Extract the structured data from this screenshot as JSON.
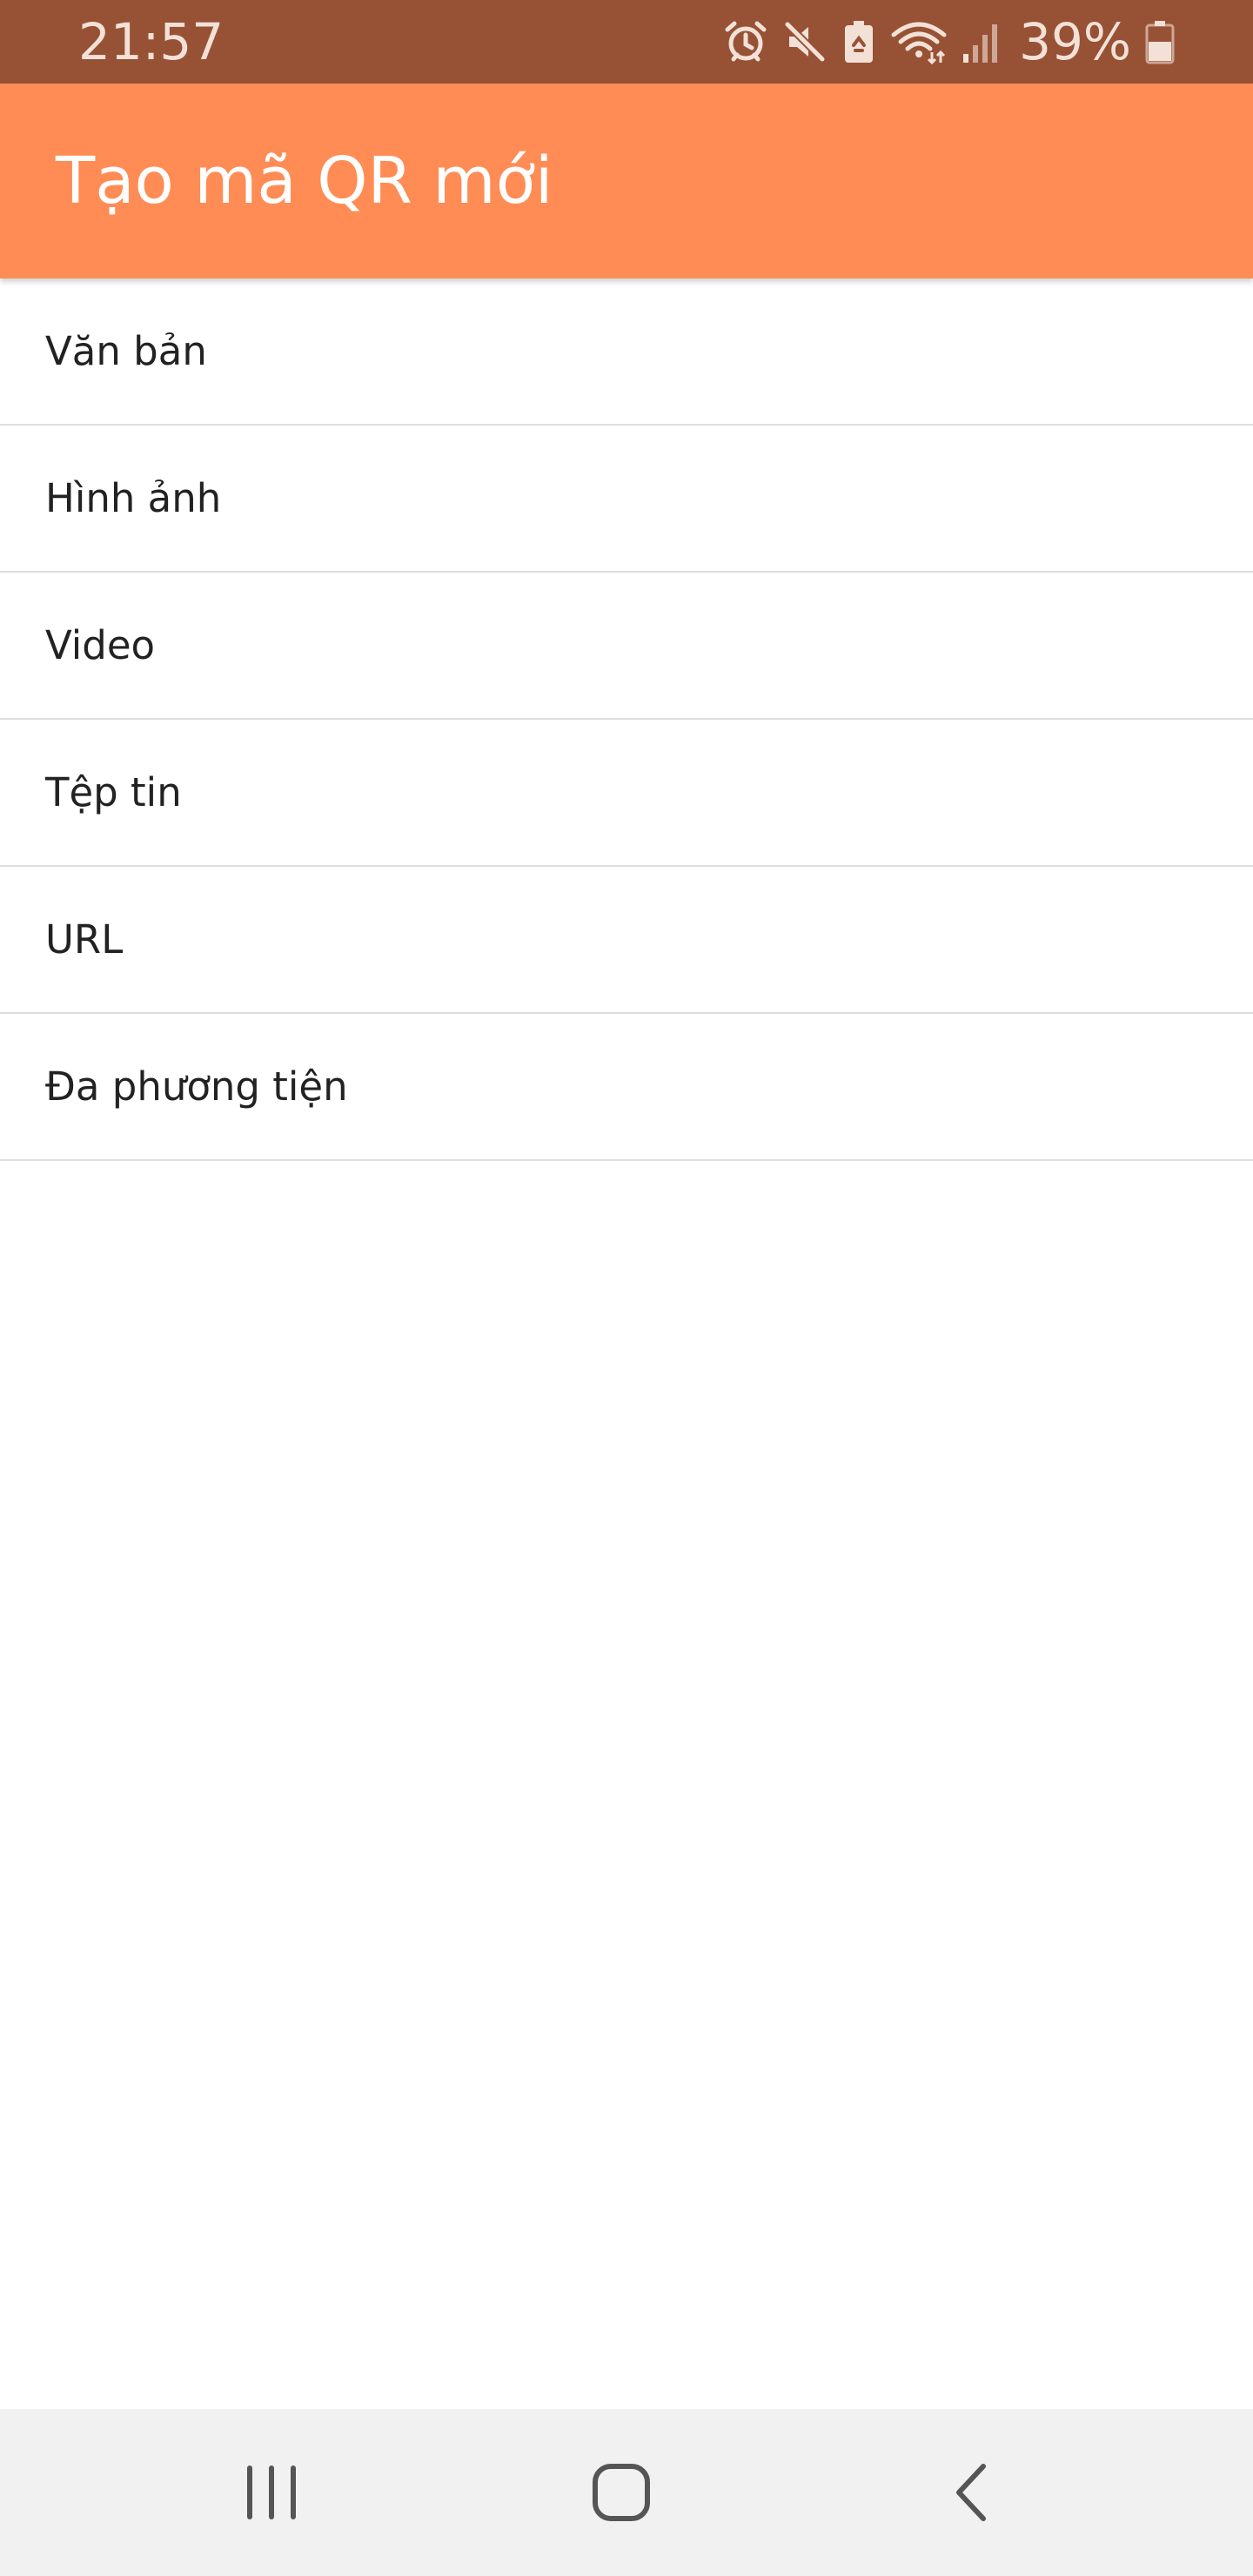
{
  "status_bar": {
    "time": "21:57",
    "battery_percent": "39%",
    "icons": [
      "alarm-icon",
      "mute-icon",
      "battery-saver-icon",
      "wifi-icon",
      "signal-icon",
      "battery-icon"
    ]
  },
  "app_bar": {
    "title": "Tạo mã QR mới",
    "background_color": "#ff8c55"
  },
  "menu": {
    "items": [
      {
        "label": "Văn bản"
      },
      {
        "label": "Hình ảnh"
      },
      {
        "label": "Video"
      },
      {
        "label": "Tệp tin"
      },
      {
        "label": "URL"
      },
      {
        "label": "Đa phương tiện"
      }
    ]
  },
  "nav_bar": {
    "buttons": [
      "recent-apps-icon",
      "home-icon",
      "back-icon"
    ]
  },
  "colors": {
    "status_bar": "#975235",
    "app_bar": "#ff8c55",
    "divider": "#dedede",
    "nav_bar": "#f1f1f1"
  }
}
